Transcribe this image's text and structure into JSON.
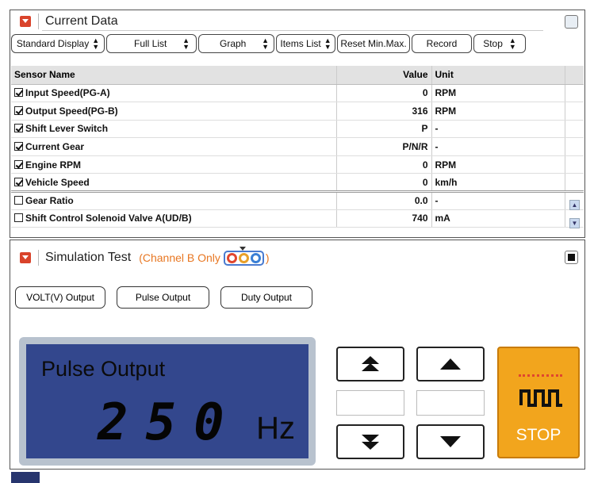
{
  "current_data": {
    "title": "Current Data",
    "toolbar": {
      "standard_display": "Standard Display",
      "full_list": "Full List",
      "graph": "Graph",
      "items_list": "Items List",
      "reset": "Reset Min.Max.",
      "record": "Record",
      "stop": "Stop"
    },
    "columns": {
      "name": "Sensor Name",
      "value": "Value",
      "unit": "Unit"
    },
    "rows": [
      {
        "name": "Input Speed(PG-A)",
        "value": "0",
        "unit": "RPM",
        "checked": true
      },
      {
        "name": "Output Speed(PG-B)",
        "value": "316",
        "unit": "RPM",
        "checked": true
      },
      {
        "name": "Shift Lever Switch",
        "value": "P",
        "unit": "-",
        "checked": true
      },
      {
        "name": "Current Gear",
        "value": "P/N/R",
        "unit": "-",
        "checked": true
      },
      {
        "name": "Engine RPM",
        "value": "0",
        "unit": "RPM",
        "checked": true
      },
      {
        "name": "Vehicle Speed",
        "value": "0",
        "unit": "km/h",
        "checked": true
      },
      {
        "name": "Gear Ratio",
        "value": "0.0",
        "unit": "-",
        "checked": false
      },
      {
        "name": "Shift Control Solenoid Valve A(UD/B)",
        "value": "740",
        "unit": "mA",
        "checked": false
      }
    ]
  },
  "simulation": {
    "title": "Simulation Test",
    "subtitle_prefix": "(Channel B Only",
    "subtitle_suffix": ")",
    "buttons": {
      "volt": "VOLT(V) Output",
      "pulse": "Pulse Output",
      "duty": "Duty Output"
    },
    "display": {
      "label": "Pulse Output",
      "value": "250",
      "unit": "Hz"
    },
    "stop_label": "STOP"
  },
  "colors": {
    "accent": "#d9432b",
    "lcd": "#33478d",
    "stop": "#f2a51d",
    "channel": "#e87722"
  }
}
